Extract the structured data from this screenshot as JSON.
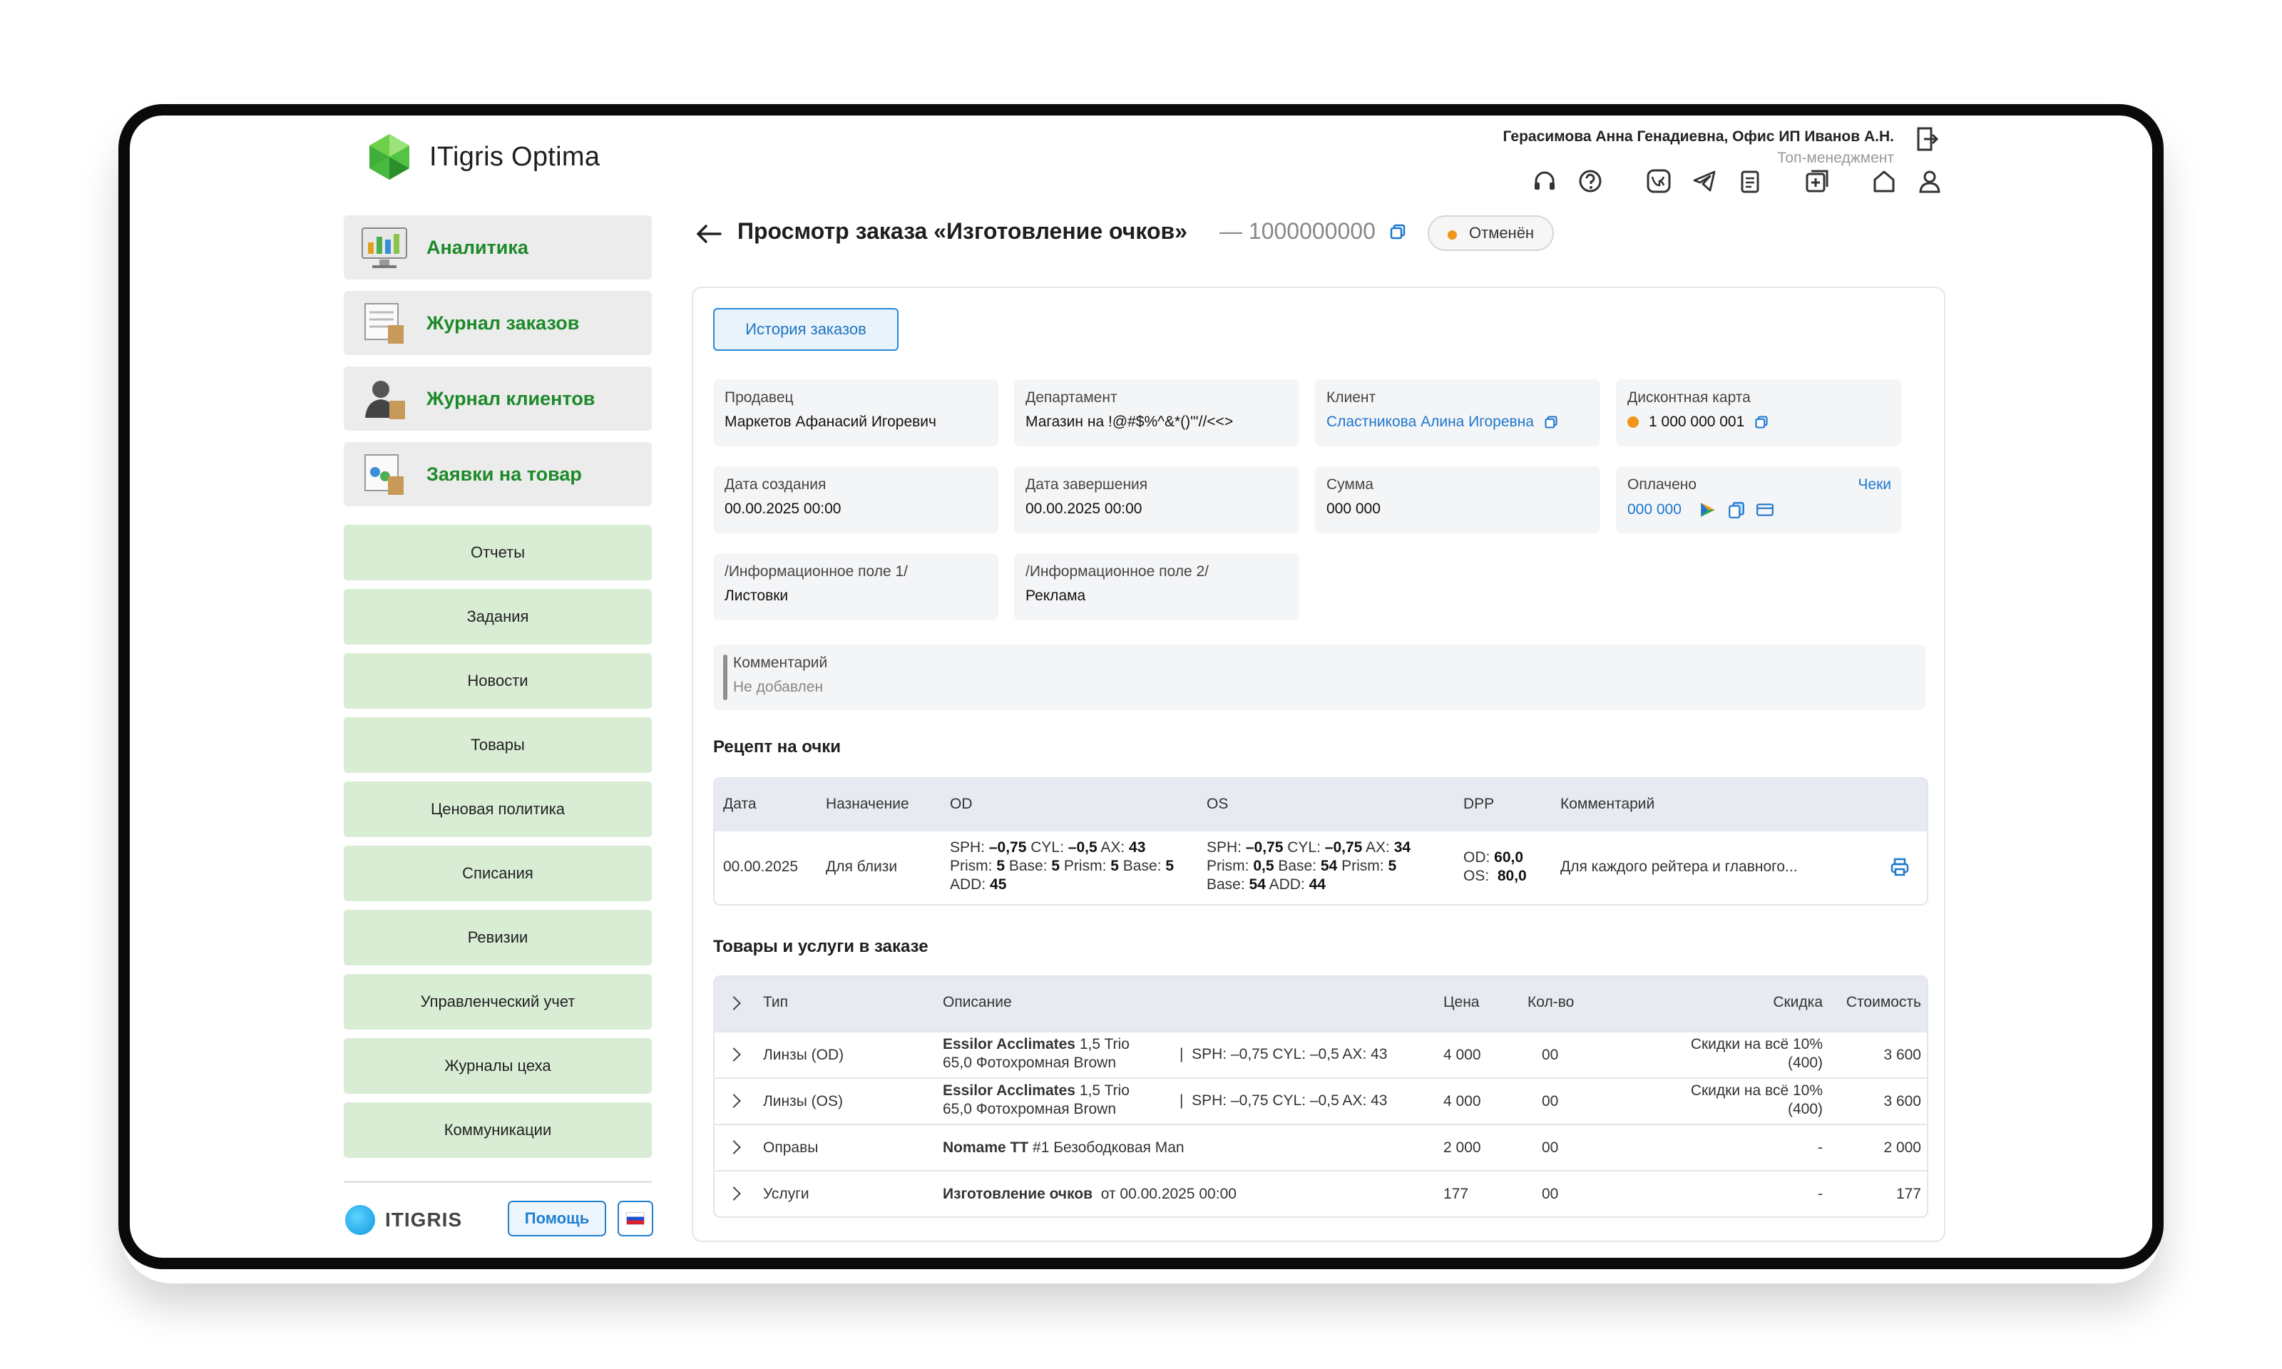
{
  "app": {
    "logo_text": "ITigris Optima"
  },
  "user": {
    "name": "Герасимова Анна Генадиевна, Офис ИП Иванов А.Н.",
    "role": "Топ-менеджмент"
  },
  "sidebar": {
    "main_items": [
      {
        "label": "Аналитика"
      },
      {
        "label": "Журнал заказов"
      },
      {
        "label": "Журнал клиентов"
      },
      {
        "label": "Заявки на товар"
      }
    ],
    "items": [
      {
        "label": "Отчеты"
      },
      {
        "label": "Задания"
      },
      {
        "label": "Новости"
      },
      {
        "label": "Товары"
      },
      {
        "label": "Ценовая политика"
      },
      {
        "label": "Списания"
      },
      {
        "label": "Ревизии"
      },
      {
        "label": "Управленческий учет"
      },
      {
        "label": "Журналы цеха"
      },
      {
        "label": "Коммуникации"
      }
    ],
    "brand": "ITIGRIS",
    "help_label": "Помощь"
  },
  "page": {
    "title": "Просмотр заказа «Изготовление очков»",
    "order_number": "— 1000000000",
    "status": "Отменён",
    "history_button": "История заказов"
  },
  "fields": {
    "seller": {
      "label": "Продавец",
      "value": "Маркетов Афанасий Игоревич"
    },
    "department": {
      "label": "Департамент",
      "value": "Магазин на !@#$%^&*()\"'//<<>"
    },
    "client": {
      "label": "Клиент",
      "value": "Сластникова Алина Игоревна"
    },
    "discount_card": {
      "label": "Дисконтная карта",
      "value": "1 000 000 001"
    },
    "created": {
      "label": "Дата создания",
      "value": "00.00.2025 00:00"
    },
    "completed": {
      "label": "Дата завершения",
      "value": "00.00.2025 00:00"
    },
    "sum": {
      "label": "Сумма",
      "value": "000 000"
    },
    "paid": {
      "label": "Оплачено",
      "value": "000 000",
      "receipts_link": "Чеки"
    },
    "info1": {
      "label": "/Информационное поле 1/",
      "value": "Листовки"
    },
    "info2": {
      "label": "/Информационное поле 2/",
      "value": "Реклама"
    },
    "comment": {
      "label": "Комментарий",
      "value": "Не добавлен"
    }
  },
  "recipe": {
    "section_title": "Рецепт на очки",
    "headers": [
      "Дата",
      "Назначение",
      "OD",
      "OS",
      "DPP",
      "Комментарий"
    ],
    "row": {
      "date": "00.00.2025",
      "purpose": "Для близи",
      "od": {
        "sph": "–0,75",
        "cyl": "–0,5",
        "ax": "43",
        "prism1": "5",
        "base1": "5",
        "prism2": "5",
        "base2": "5",
        "add": "45"
      },
      "os": {
        "sph": "–0,75",
        "cyl": "–0,75",
        "ax": "34",
        "prism1": "0,5",
        "base1": "54",
        "prism2": "5",
        "base2": "54",
        "add": "44"
      },
      "dpp_od": "60,0",
      "dpp_os": "80,0",
      "comment": "Для каждого рейтера и главного..."
    }
  },
  "goods": {
    "section_title": "Товары и услуги в заказе",
    "headers": [
      "Тип",
      "Описание",
      "Цена",
      "Кол-во",
      "Скидка",
      "Стоимость"
    ],
    "rows": [
      {
        "type": "Линзы (OD)",
        "name": "Essilor Acclimates",
        "name_extra": "1,5 Trio",
        "name_line2": "65,0 Фотохромная Brown",
        "params": "SPH: –0,75 CYL: –0,5 AX: 43",
        "price": "4 000",
        "qty": "00",
        "discount": "Скидки на всё 10%",
        "discount2": "(400)",
        "cost": "3 600"
      },
      {
        "type": "Линзы (OS)",
        "name": "Essilor Acclimates",
        "name_extra": "1,5 Trio",
        "name_line2": "65,0 Фотохромная Brown",
        "params": "SPH: –0,75 CYL: –0,5 AX: 43",
        "price": "4 000",
        "qty": "00",
        "discount": "Скидки на всё 10%",
        "discount2": "(400)",
        "cost": "3 600"
      },
      {
        "type": "Оправы",
        "name": "Nomame TT",
        "name_extra": "#1 Безободковая Man",
        "name_line2": "",
        "params": "",
        "price": "2 000",
        "qty": "00",
        "discount": "-",
        "discount2": "",
        "cost": "2 000"
      },
      {
        "type": "Услуги",
        "name": "Изготовление очков",
        "name_extra": "от 00.00.2025 00:00",
        "name_line2": "",
        "params": "",
        "price": "177",
        "qty": "00",
        "discount": "-",
        "discount2": "",
        "cost": "177"
      }
    ]
  },
  "colors": {
    "accent_green": "#1d8a2a",
    "link_blue": "#1c77cf",
    "status_orange": "#f0961b",
    "submenu_bg": "#d9edd5"
  }
}
